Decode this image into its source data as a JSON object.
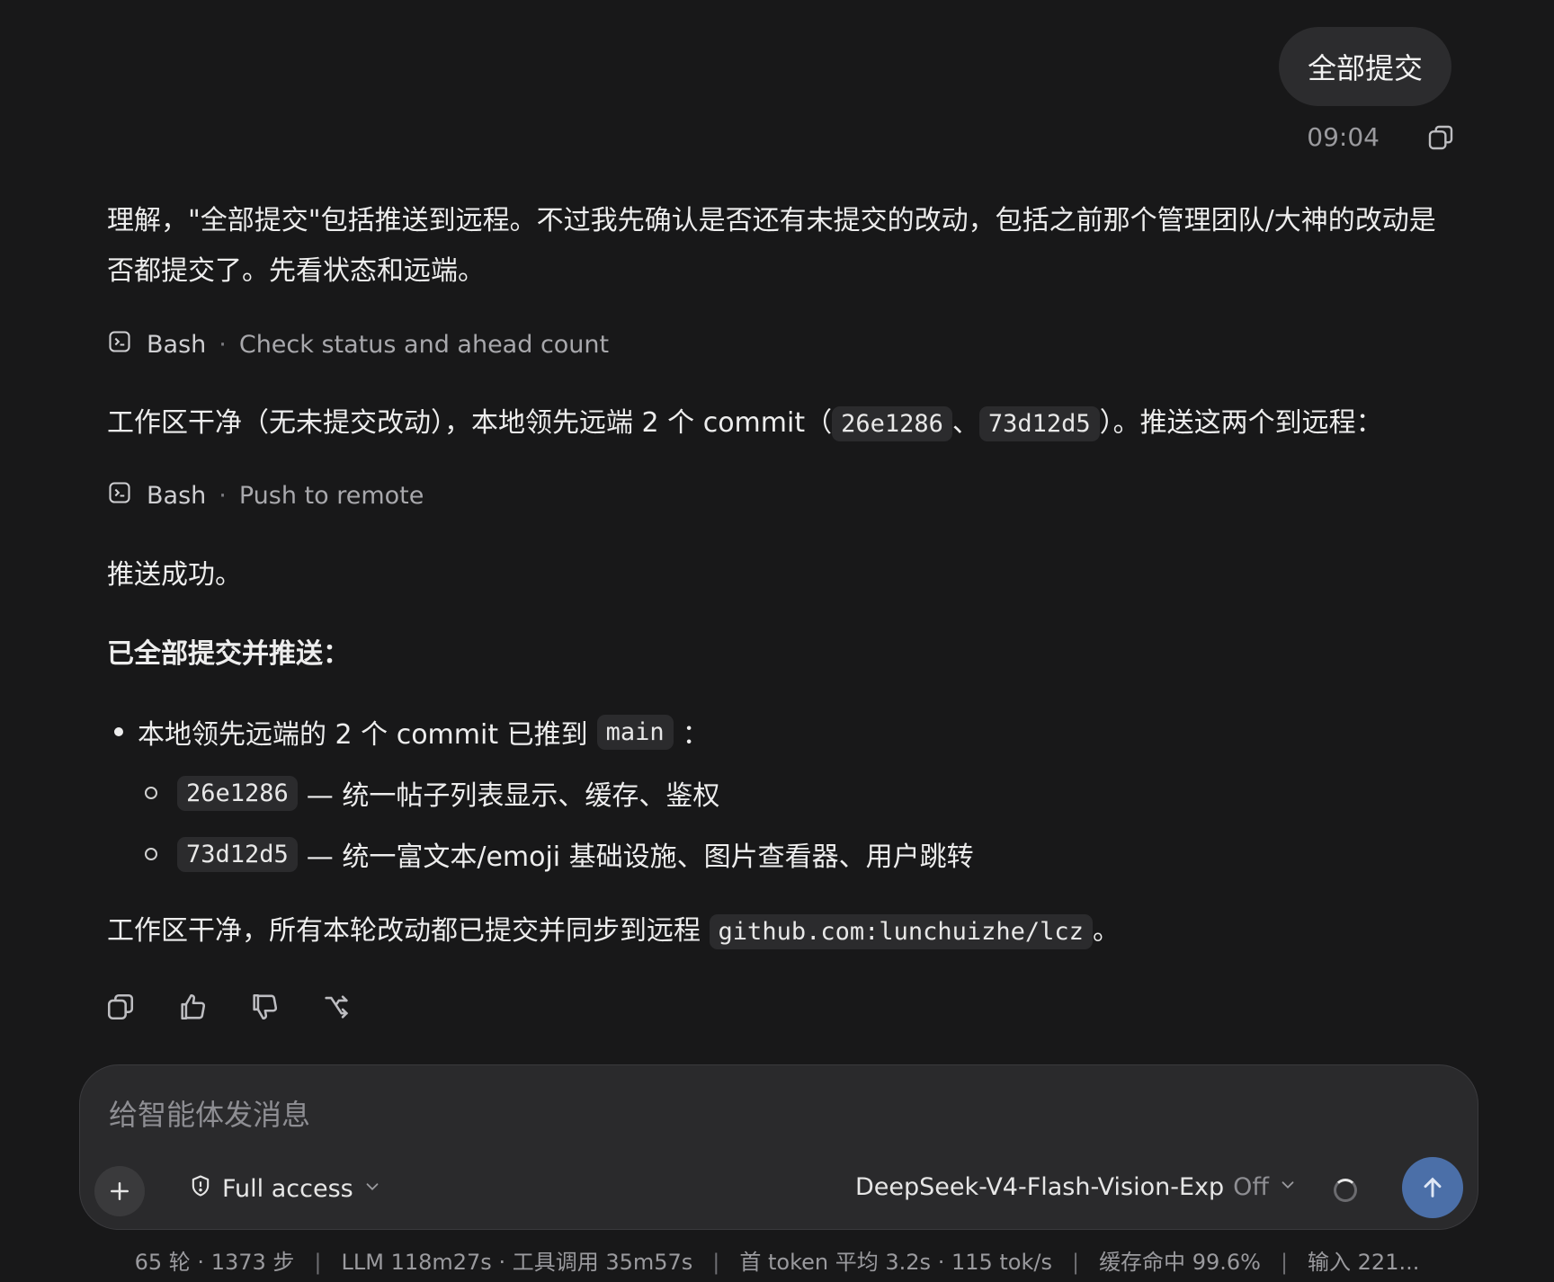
{
  "user_message": {
    "text": "全部提交",
    "time": "09:04"
  },
  "assistant": {
    "para1": "理解，\"全部提交\"包括推送到远程。不过我先确认是否还有未提交的改动，包括之前那个管理团队/大神的改动是否都提交了。先看状态和远端。",
    "tool1": {
      "name": "Bash",
      "desc": "Check status and ahead count"
    },
    "line1": {
      "prefix": "工作区干净（无未提交改动），本地领先远端 2 个 commit（",
      "commit_a": "26e1286",
      "sep": "、",
      "commit_b": "73d12d5",
      "suffix": "）。推送这两个到远程："
    },
    "tool2": {
      "name": "Bash",
      "desc": "Push to remote"
    },
    "line2": "推送成功。",
    "heading": "已全部提交并推送：",
    "list": {
      "item_prefix": "本地领先远端的 2 个 commit 已推到",
      "branch": "main",
      "item_suffix": "：",
      "sub": [
        {
          "hash": "26e1286",
          "text": "— 统一帖子列表显示、缓存、鉴权"
        },
        {
          "hash": "73d12d5",
          "text": "— 统一富文本/emoji 基础设施、图片查看器、用户跳转"
        }
      ]
    },
    "line3": {
      "prefix": "工作区干净，所有本轮改动都已提交并同步到远程",
      "remote": "github.com:lunchuizhe/lcz",
      "suffix": "。"
    }
  },
  "composer": {
    "placeholder": "给智能体发消息",
    "access_label": "Full access",
    "model_label": "DeepSeek-V4-Flash-Vision-Exp",
    "model_mode": "Off"
  },
  "status": {
    "rounds": "65 轮 · 1373 步",
    "llm": "LLM 118m27s · 工具调用 35m57s",
    "token": "首 token 平均 3.2s · 115 tok/s",
    "cache": "缓存命中 99.6%",
    "input": "输入 221...",
    "separator": "|"
  },
  "icons": [
    "copy-icon",
    "thumbs-up-icon",
    "thumbs-down-icon",
    "branch-icon",
    "terminal-icon",
    "shield-icon",
    "chevron-down-icon",
    "plus-icon",
    "arrow-up-icon",
    "spinner-icon"
  ]
}
